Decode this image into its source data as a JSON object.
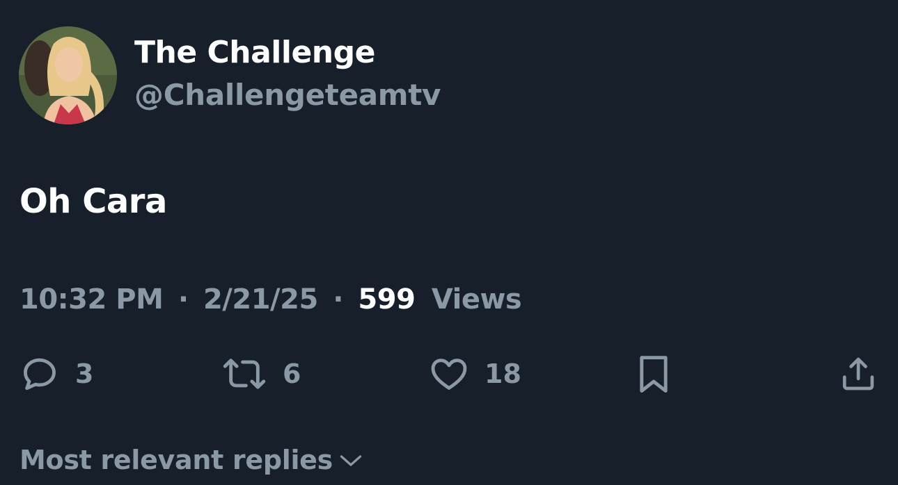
{
  "author": {
    "display_name": "The Challenge",
    "handle": "@Challengeteamtv"
  },
  "tweet": {
    "text": "Oh Cara",
    "time": "10:32 PM",
    "separator": "·",
    "date": "2/21/25",
    "views_count": "599",
    "views_label": "Views"
  },
  "actions": {
    "replies": "3",
    "reposts": "6",
    "likes": "18"
  },
  "replies_sort": {
    "label": "Most relevant replies"
  },
  "icons": {
    "reply": "reply-bubble-icon",
    "repost": "repost-arrows-icon",
    "like": "heart-icon",
    "bookmark": "bookmark-icon",
    "share": "share-upload-icon",
    "sort": "chevron-down-icon"
  },
  "colors": {
    "background": "#17202a",
    "primary_text": "#ffffff",
    "secondary_text": "#8b98a5"
  }
}
